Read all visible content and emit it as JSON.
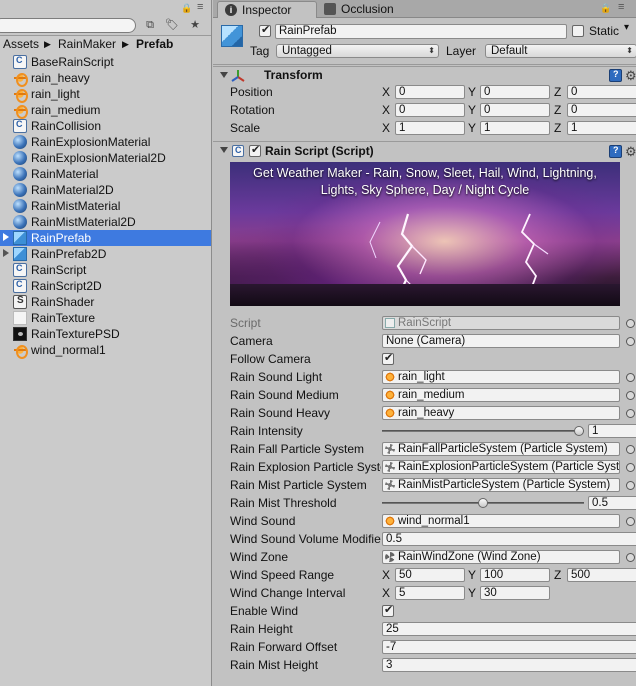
{
  "project": {
    "breadcrumb": [
      "Assets",
      "RainMaker",
      "Prefab"
    ],
    "selected_index": 11,
    "assets": [
      {
        "name": "BaseRainScript",
        "icon": "script-icon"
      },
      {
        "name": "rain_heavy",
        "icon": "audio-icon"
      },
      {
        "name": "rain_light",
        "icon": "audio-icon"
      },
      {
        "name": "rain_medium",
        "icon": "audio-icon"
      },
      {
        "name": "RainCollision",
        "icon": "script-icon"
      },
      {
        "name": "RainExplosionMaterial",
        "icon": "material-icon"
      },
      {
        "name": "RainExplosionMaterial2D",
        "icon": "material-icon"
      },
      {
        "name": "RainMaterial",
        "icon": "material-icon"
      },
      {
        "name": "RainMaterial2D",
        "icon": "material-icon"
      },
      {
        "name": "RainMistMaterial",
        "icon": "material-icon"
      },
      {
        "name": "RainMistMaterial2D",
        "icon": "material-icon"
      },
      {
        "name": "RainPrefab",
        "icon": "prefab-icon"
      },
      {
        "name": "RainPrefab2D",
        "icon": "prefab-icon"
      },
      {
        "name": "RainScript",
        "icon": "script-icon"
      },
      {
        "name": "RainScript2D",
        "icon": "script-icon"
      },
      {
        "name": "RainShader",
        "icon": "shader-icon"
      },
      {
        "name": "RainTexture",
        "icon": "texture-icon"
      },
      {
        "name": "RainTexturePSD",
        "icon": "texture-psd-icon"
      },
      {
        "name": "wind_normal1",
        "icon": "audio-icon"
      }
    ]
  },
  "inspector": {
    "tabs": [
      "Inspector",
      "Occlusion"
    ],
    "object_name": "RainPrefab",
    "static_label": "Static",
    "tag_label": "Tag",
    "tag_value": "Untagged",
    "layer_label": "Layer",
    "layer_value": "Default",
    "transform": {
      "title": "Transform",
      "rows": [
        {
          "label": "Position",
          "x": "0",
          "y": "0",
          "z": "0"
        },
        {
          "label": "Rotation",
          "x": "0",
          "y": "0",
          "z": "0"
        },
        {
          "label": "Scale",
          "x": "1",
          "y": "1",
          "z": "1"
        }
      ]
    },
    "rain_script": {
      "title": "Rain Script (Script)",
      "banner_line1": "Get Weather Maker - Rain, Snow, Sleet, Hail, Wind, Lightning,",
      "banner_line2": "Lights, Sky Sphere, Day / Night Cycle",
      "script_label": "Script",
      "script_value": "RainScript",
      "camera_label": "Camera",
      "camera_value": "None (Camera)",
      "follow_camera_label": "Follow Camera",
      "sound_light_label": "Rain Sound Light",
      "sound_light_value": "rain_light",
      "sound_medium_label": "Rain Sound Medium",
      "sound_medium_value": "rain_medium",
      "sound_heavy_label": "Rain Sound Heavy",
      "sound_heavy_value": "rain_heavy",
      "intensity_label": "Rain Intensity",
      "intensity_value": "1",
      "intensity_fraction": 1.0,
      "fall_ps_label": "Rain Fall Particle System",
      "fall_ps_value": "RainFallParticleSystem (Particle System)",
      "explosion_ps_label": "Rain Explosion Particle System",
      "explosion_ps_value": "RainExplosionParticleSystem (Particle System)",
      "mist_ps_label": "Rain Mist Particle System",
      "mist_ps_value": "RainMistParticleSystem (Particle System)",
      "mist_threshold_label": "Rain Mist Threshold",
      "mist_threshold_value": "0.5",
      "mist_threshold_fraction": 0.5,
      "wind_sound_label": "Wind Sound",
      "wind_sound_value": "wind_normal1",
      "wind_volume_label": "Wind Sound Volume Modifier",
      "wind_volume_value": "0.5",
      "wind_zone_label": "Wind Zone",
      "wind_zone_value": "RainWindZone (Wind Zone)",
      "wind_speed_label": "Wind Speed Range",
      "wind_speed_x": "50",
      "wind_speed_y": "100",
      "wind_speed_z": "500",
      "wind_change_label": "Wind Change Interval",
      "wind_change_x": "5",
      "wind_change_y": "30",
      "enable_wind_label": "Enable Wind",
      "rain_height_label": "Rain Height",
      "rain_height_value": "25",
      "forward_offset_label": "Rain Forward Offset",
      "forward_offset_value": "-7",
      "mist_height_label": "Rain Mist Height",
      "mist_height_value": "3"
    },
    "axis": {
      "x": "X",
      "y": "Y",
      "z": "Z"
    }
  }
}
